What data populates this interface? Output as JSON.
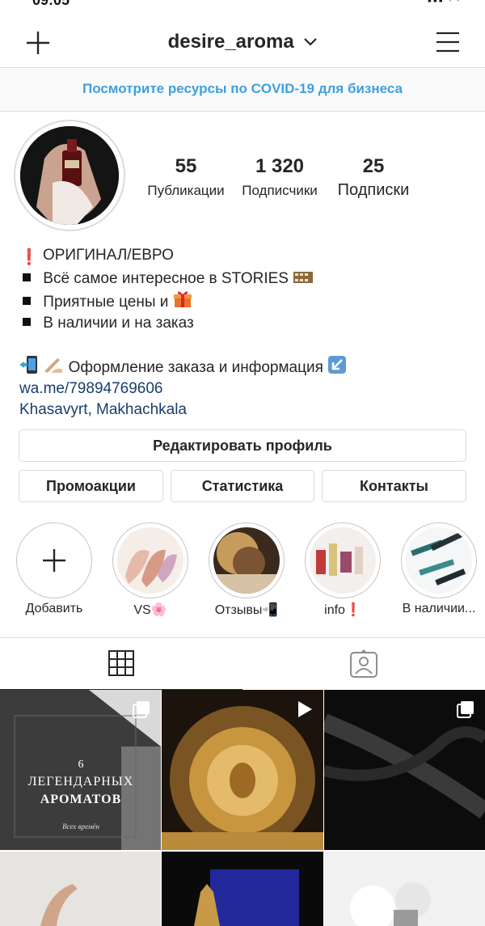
{
  "status_bar": {
    "time": "09:05",
    "system": "▪▪▪ ◠"
  },
  "header": {
    "username": "desire_aroma"
  },
  "banner": {
    "text": "Посмотрите ресурсы по COVID-19 для бизнеса"
  },
  "stats": [
    {
      "value": "55",
      "label": "Публикации"
    },
    {
      "value": "1 320",
      "label": "Подписчики"
    },
    {
      "value": "25",
      "label": "Подписки"
    }
  ],
  "bio": {
    "line1": "ОРИГИНАЛ/ЕВРО",
    "line2": "Всё самое интересное в STORIES",
    "line3": "Приятные цены и",
    "line4": "В наличии и на заказ",
    "line5": "Оформление заказа и информация",
    "link": "wa.me/79894769606",
    "location": "Khasavyrt, Makhachkala"
  },
  "buttons": {
    "edit_profile": "Редактировать профиль",
    "promotions": "Промоакции",
    "insights": "Статистика",
    "contacts": "Контакты"
  },
  "highlights": [
    {
      "label": "Добавить"
    },
    {
      "label": "VS🌸"
    },
    {
      "label": "Отзывы📲"
    },
    {
      "label": "info❗"
    },
    {
      "label": "В наличии..."
    }
  ],
  "posts": [
    {
      "title": "ЛЕГЕНДАРНЫХ",
      "subtitle": "АРОМАТОВ",
      "caption": "Всех времён",
      "number": "6"
    }
  ],
  "colors": {
    "link_blue": "#3f9fe0",
    "border": "#dbdbdb",
    "text": "#262626"
  }
}
